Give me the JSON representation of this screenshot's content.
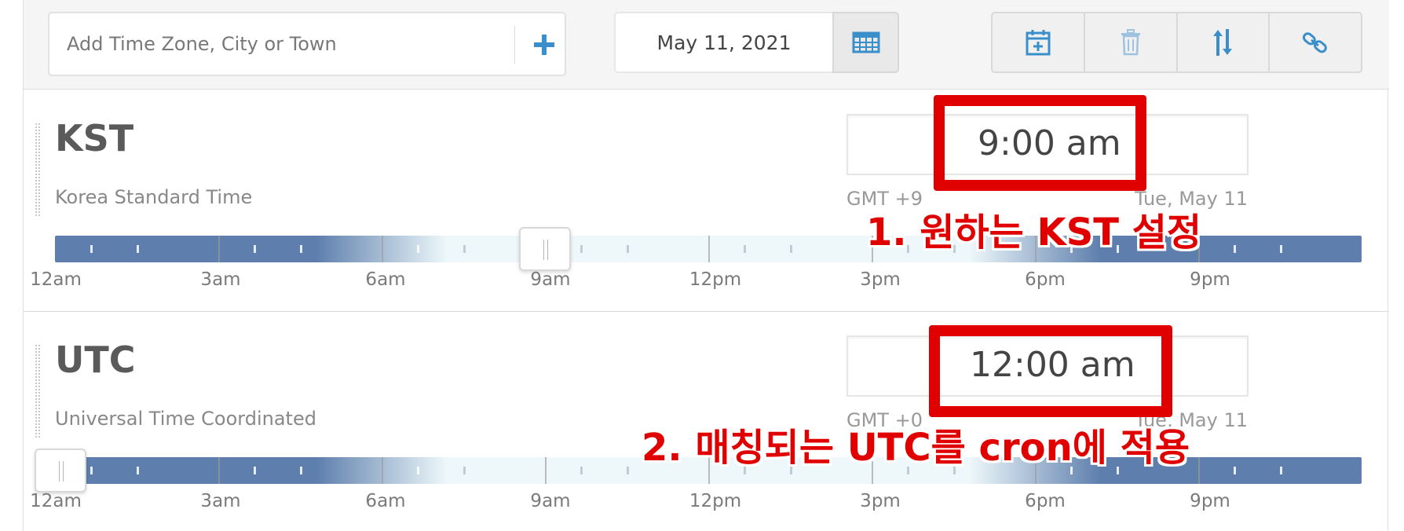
{
  "toolbar": {
    "search_placeholder": "Add Time Zone, City or Town",
    "date": "May 11, 2021"
  },
  "hour_labels": [
    "12am",
    "3am",
    "6am",
    "9am",
    "12pm",
    "3pm",
    "6pm",
    "9pm"
  ],
  "zones": [
    {
      "abbr": "KST",
      "name": "Korea Standard Time",
      "time": "9:00 am",
      "gmt": "GMT +9",
      "date": "Tue, May 11",
      "slider_hour": 9
    },
    {
      "abbr": "UTC",
      "name": "Universal Time Coordinated",
      "time": "12:00 am",
      "gmt": "GMT +0",
      "date": "Tue, May 11",
      "slider_hour": 0
    }
  ],
  "annotations": {
    "step1": "1. 원하는 KST 설정",
    "step2": "2. 매칭되는 UTC를 cron에 적용"
  },
  "colors": {
    "accent": "#3a8fcb",
    "night": "#5e7fad",
    "day": "#eef8fa",
    "annotation": "#e00000"
  },
  "icons": {
    "add": "plus-icon",
    "calendar": "calendar-grid-icon",
    "add_event": "calendar-plus-icon",
    "delete": "trash-icon",
    "sort": "sort-arrows-icon",
    "link": "link-icon"
  }
}
